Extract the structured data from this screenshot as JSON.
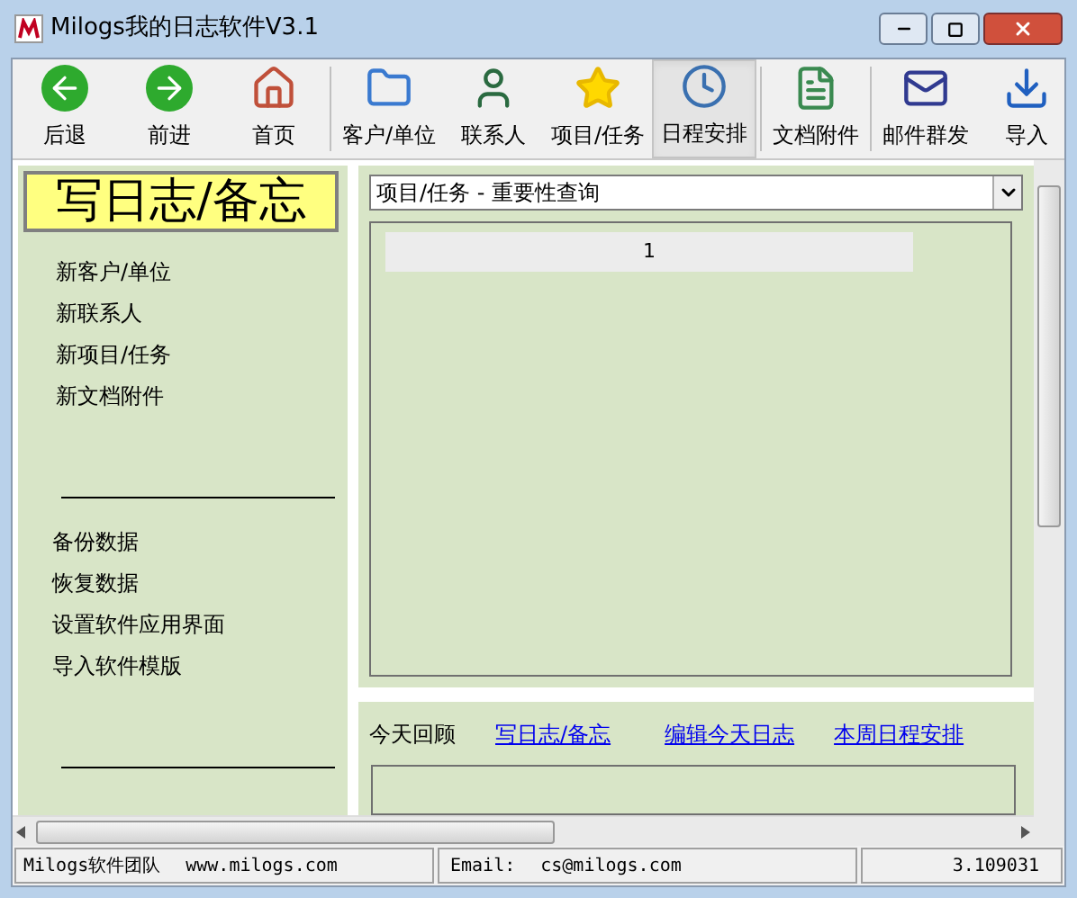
{
  "window": {
    "title": "Milogs我的日志软件V3.1"
  },
  "toolbar": [
    {
      "label": "后退",
      "kind": "back",
      "selected": false
    },
    {
      "label": "前进",
      "kind": "forward",
      "selected": false
    },
    {
      "label": "首页",
      "kind": "home",
      "selected": false
    },
    {
      "label": "客户/单位",
      "kind": "clients",
      "selected": false
    },
    {
      "label": "联系人",
      "kind": "contacts",
      "selected": false
    },
    {
      "label": "项目/任务",
      "kind": "projects",
      "selected": false
    },
    {
      "label": "日程安排",
      "kind": "schedule",
      "selected": true
    },
    {
      "label": "文档附件",
      "kind": "docs",
      "selected": false
    },
    {
      "label": "邮件群发",
      "kind": "mail",
      "selected": false
    },
    {
      "label": "导入",
      "kind": "import",
      "selected": false
    }
  ],
  "sidebar": {
    "title": "写日志/备忘",
    "groups": [
      [
        "新客户/单位",
        "新联系人",
        "新项目/任务",
        "新文档附件"
      ],
      [
        "备份数据",
        "恢复数据",
        "设置软件应用界面",
        "导入软件模版"
      ]
    ]
  },
  "query": {
    "value": "项目/任务 - 重要性查询",
    "table": {
      "columns": [
        "1"
      ]
    }
  },
  "review": {
    "label": "今天回顾",
    "links": [
      "写日志/备忘",
      "编辑今天日志",
      "本周日程安排"
    ]
  },
  "status_bar": [
    "Milogs软件团队",
    "www.milogs.com",
    "Email:",
    "cs@milogs.com",
    "3.109031"
  ]
}
